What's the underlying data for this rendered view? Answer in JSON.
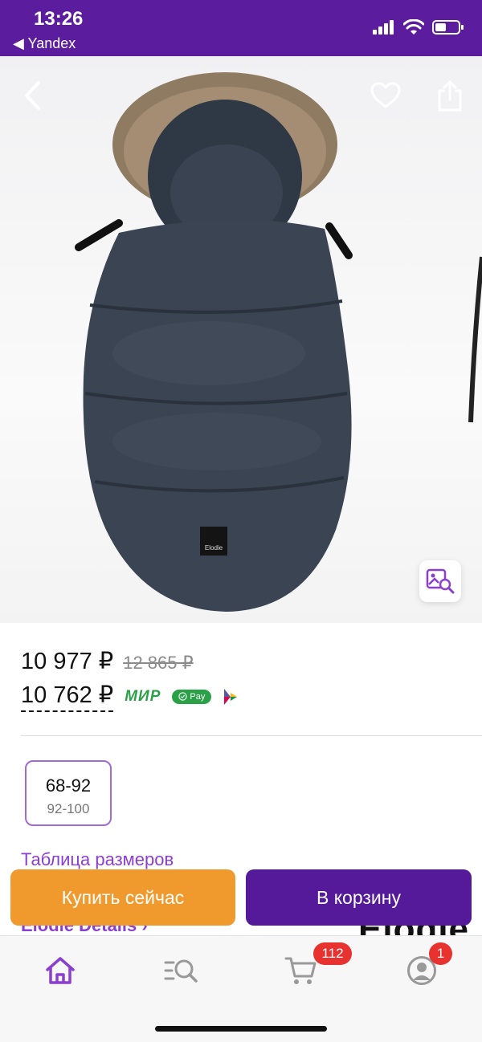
{
  "status_bar": {
    "time": "13:26",
    "back_app": "◀ Yandex"
  },
  "product": {
    "brand_tag": "Elodie",
    "price": "10 977 ₽",
    "old_price": "12 865 ₽",
    "card_price": "10 762 ₽",
    "payment_badges": {
      "mir": "МИР",
      "spay": "Pay"
    }
  },
  "sizes": [
    {
      "main": "68-92",
      "alt": "92-100"
    }
  ],
  "links": {
    "size_table": "Таблица размеров",
    "details": "Elodie Details ›"
  },
  "brand_logo_peek": "Elodie",
  "actions": {
    "buy_now": "Купить сейчас",
    "add_to_cart": "В корзину"
  },
  "tabbar": {
    "cart_badge": "112",
    "profile_badge": "1"
  },
  "colors": {
    "brand_purple": "#5b1c9e",
    "accent_purple": "#8b3fcf",
    "buy_orange": "#f09a2e",
    "cart_button": "#541a9a",
    "badge_red": "#e8322f",
    "mir_green": "#2aa147"
  },
  "icons": [
    "back-icon",
    "heart-icon",
    "share-icon",
    "visual-search-icon",
    "home-icon",
    "catalog-search-icon",
    "cart-icon",
    "profile-icon",
    "signal-icon",
    "wifi-icon",
    "battery-icon",
    "sbp-icon"
  ]
}
